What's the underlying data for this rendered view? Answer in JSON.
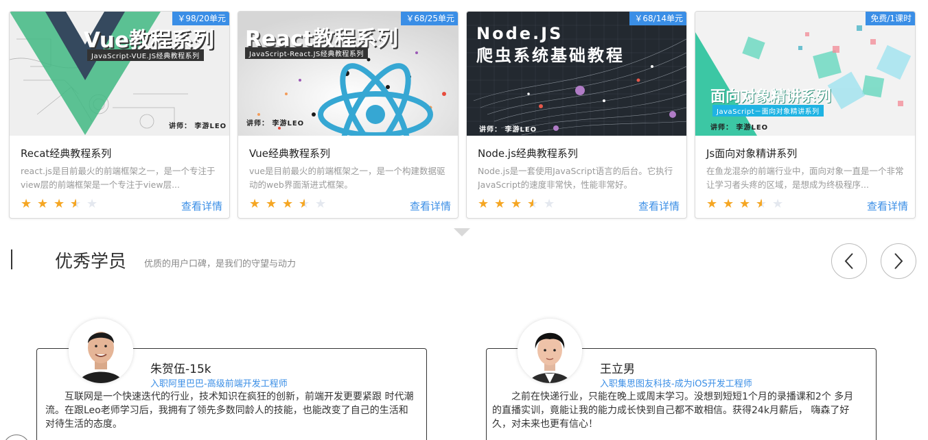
{
  "courses": [
    {
      "price": "￥98/20单元",
      "thumb_title": "Vue教程系列",
      "thumb_sub": "JavaScript-VUE.JS经典教程系列",
      "lecturer": "讲师： 李游LEO",
      "title": "Recat经典教程系列",
      "desc": "react.js是目前最火的前端框架之一，是一个专注于view层的前端框架是一个专注于view层...",
      "rating": 3.5,
      "detail": "查看详情"
    },
    {
      "price": "￥68/25单元",
      "thumb_title": "React教程系列",
      "thumb_sub": "JavaScript-React.JS经典教程系列",
      "lecturer": "讲师： 李游LEO",
      "title": "Vue经典教程系列",
      "desc": "vue是目前最火的前端框架之一，是一个构建数据驱动的web界面渐进式框架。",
      "rating": 3.5,
      "detail": "查看详情"
    },
    {
      "price": "￥68/14单元",
      "thumb_title": "Node.JS",
      "thumb_title2": "爬虫系统基础教程",
      "lecturer": "讲师： 李游LEO",
      "title": "Node.js经典教程系列",
      "desc": "Node.js是一套使用JavaScript语言的后台。它执行JavaScript的速度非常快，性能非常好。",
      "rating": 3.5,
      "detail": "查看详情"
    },
    {
      "price": "免费/1课时",
      "thumb_title": "面向对象精讲系列",
      "thumb_sub": "JavaScript－面向对象精讲系列",
      "lecturer": "讲师： 李游LEO",
      "title": "Js面向对象精讲系列",
      "desc": "在鱼龙混杂的前端行业中，面向对象一直是一个非常让学习者头疼的区域，是想成为终极程序...",
      "rating": 3.5,
      "detail": "查看详情"
    }
  ],
  "section": {
    "title": "优秀学员",
    "subtitle": "优质的用户口碑，是我们的守望与动力"
  },
  "icons": {
    "prev": "chevron-left-icon",
    "next": "chevron-right-icon",
    "star": "star-icon"
  },
  "testimonials": [
    {
      "name": "朱贺伍-15k",
      "role": "入职阿里巴巴-高级前端开发工程师",
      "text": "互联网是一个快速迭代的行业，技术知识在疯狂的创新，前端开发更要紧跟 时代潮流。在跟Leo老师学习后，我拥有了领先多数同龄人的技能，也能改变了自己的生活和对待生活的态度。"
    },
    {
      "name": "王立男",
      "role": "入职集思图友科技-成为iOS开发工程师",
      "text": "之前在快递行业，只能在晚上或周末学习。没想到短短1个月的录播课和2个 多月的直播实训，竟能让我的能力成长快到自己都不敢相信。获得24k月薪后， 嗨森了好久，对未来也更有信心！"
    }
  ],
  "colors": {
    "accent": "#3a8ee6",
    "star": "#f5a623",
    "star_empty": "#e4e8ef"
  }
}
